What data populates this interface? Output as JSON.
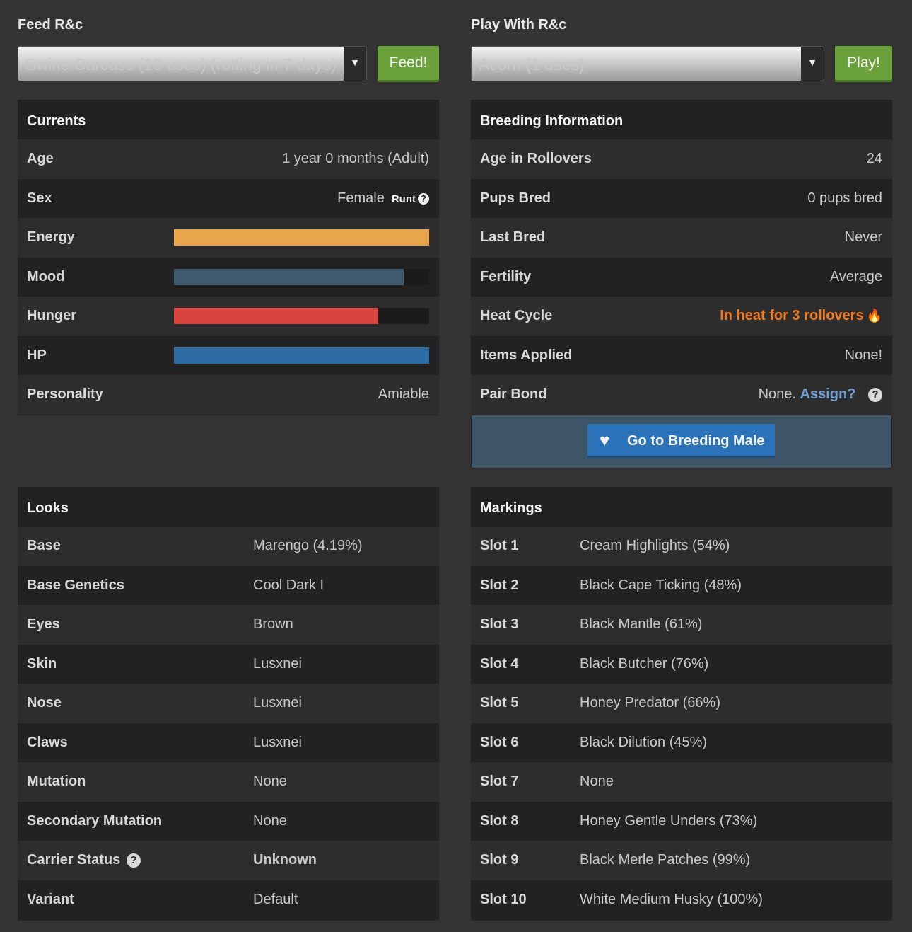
{
  "feed": {
    "title": "Feed R&c",
    "selected": "Swine Carcass (10 uses) (rotting in 7 days)",
    "button": "Feed!"
  },
  "play": {
    "title": "Play With R&c",
    "selected": "Acorn (1 uses)",
    "button": "Play!"
  },
  "currents": {
    "title": "Currents",
    "age_label": "Age",
    "age_value": "1 year 0 months (Adult)",
    "sex_label": "Sex",
    "sex_value": "Female",
    "runt_label": "Runt",
    "energy_label": "Energy",
    "mood_label": "Mood",
    "hunger_label": "Hunger",
    "hp_label": "HP",
    "personality_label": "Personality",
    "personality_value": "Amiable",
    "bars": {
      "energy": {
        "fraction": 1.0,
        "color": "#e8a54a"
      },
      "mood": {
        "fraction": 0.9,
        "color": "#3f5b6d"
      },
      "hunger": {
        "fraction": 0.8,
        "color": "#d9443f"
      },
      "hp": {
        "fraction": 1.0,
        "color": "#2e6da4"
      }
    }
  },
  "breeding": {
    "title": "Breeding Information",
    "rows": [
      {
        "label": "Age in Rollovers",
        "value": "24"
      },
      {
        "label": "Pups Bred",
        "value": "0 pups bred"
      },
      {
        "label": "Last Bred",
        "value": "Never"
      },
      {
        "label": "Fertility",
        "value": "Average"
      }
    ],
    "heat_label": "Heat Cycle",
    "heat_value": "In heat for 3 rollovers",
    "items_label": "Items Applied",
    "items_value": "None!",
    "pair_label": "Pair Bond",
    "pair_value": "None.",
    "pair_link": "Assign?",
    "button": "Go to Breeding Male"
  },
  "looks": {
    "title": "Looks",
    "rows": [
      {
        "label": "Base",
        "value": "Marengo (4.19%)"
      },
      {
        "label": "Base Genetics",
        "value": "Cool Dark I"
      },
      {
        "label": "Eyes",
        "value": "Brown"
      },
      {
        "label": "Skin",
        "value": "Lusxnei"
      },
      {
        "label": "Nose",
        "value": "Lusxnei"
      },
      {
        "label": "Claws",
        "value": "Lusxnei"
      },
      {
        "label": "Mutation",
        "value": "None"
      },
      {
        "label": "Secondary Mutation",
        "value": "None"
      }
    ],
    "carrier_label": "Carrier Status",
    "carrier_value": "Unknown",
    "variant_label": "Variant",
    "variant_value": "Default"
  },
  "markings": {
    "title": "Markings",
    "rows": [
      {
        "label": "Slot 1",
        "value": "Cream Highlights (54%)"
      },
      {
        "label": "Slot 2",
        "value": "Black Cape Ticking (48%)"
      },
      {
        "label": "Slot 3",
        "value": "Black Mantle (61%)"
      },
      {
        "label": "Slot 4",
        "value": "Black Butcher (76%)"
      },
      {
        "label": "Slot 5",
        "value": "Honey Predator (66%)"
      },
      {
        "label": "Slot 6",
        "value": "Black Dilution (45%)"
      },
      {
        "label": "Slot 7",
        "value": "None"
      },
      {
        "label": "Slot 8",
        "value": "Honey Gentle Unders (73%)"
      },
      {
        "label": "Slot 9",
        "value": "Black Merle Patches (99%)"
      },
      {
        "label": "Slot 10",
        "value": "White Medium Husky (100%)"
      }
    ]
  }
}
